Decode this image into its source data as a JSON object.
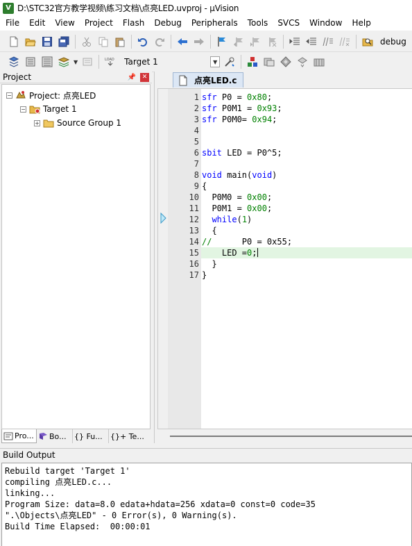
{
  "window": {
    "title": "D:\\STC32官方教学视频\\练习文档\\点亮LED.uvproj - µVision",
    "app_icon": "V"
  },
  "menu": [
    "File",
    "Edit",
    "View",
    "Project",
    "Flash",
    "Debug",
    "Peripherals",
    "Tools",
    "SVCS",
    "Window",
    "Help"
  ],
  "toolbar1": {
    "icons": [
      "new-file-icon",
      "open-folder-icon",
      "save-icon",
      "save-all-icon",
      "cut-icon",
      "copy-icon",
      "paste-icon",
      "undo-icon",
      "redo-icon",
      "navigate-back-icon",
      "navigate-forward-icon",
      "bookmark-icon",
      "prev-bookmark-icon",
      "next-bookmark-icon",
      "clear-bookmarks-icon",
      "indent-icon",
      "unindent-icon",
      "comment-icon",
      "uncomment-icon",
      "find-in-files-icon"
    ],
    "debug_label": "debug"
  },
  "toolbar2": {
    "icons": [
      "translate-icon",
      "build-icon",
      "rebuild-icon",
      "batch-build-icon",
      "stop-build-icon",
      "download-icon",
      "target-options-icon",
      "manage-components-icon",
      "select-packs-icon",
      "pack-installer-icon",
      "copy-config-icon"
    ],
    "target_value": "Target 1"
  },
  "project_panel": {
    "title": "Project",
    "tree": {
      "project": "Project: 点亮LED",
      "target": "Target 1",
      "group": "Source Group 1"
    },
    "tabs": [
      "Pro...",
      "Bo...",
      "{} Fu...",
      "{}+ Te..."
    ]
  },
  "editor": {
    "file_tab": "点亮LED.c",
    "line_numbers": [
      "1",
      "2",
      "3",
      "4",
      "5",
      "6",
      "7",
      "8",
      "9",
      "10",
      "11",
      "12",
      "13",
      "14",
      "15",
      "16",
      "17"
    ],
    "current_line": 15,
    "arrow_line": 12,
    "code": [
      [
        {
          "t": "sfr",
          "c": "kw"
        },
        {
          "t": " P0 = ",
          "c": ""
        },
        {
          "t": "0x80",
          "c": "num"
        },
        {
          "t": ";",
          "c": ""
        }
      ],
      [
        {
          "t": "sfr",
          "c": "kw"
        },
        {
          "t": " P0M1 = ",
          "c": ""
        },
        {
          "t": "0x93",
          "c": "num"
        },
        {
          "t": ";",
          "c": ""
        }
      ],
      [
        {
          "t": "sfr",
          "c": "kw"
        },
        {
          "t": " P0M0= ",
          "c": ""
        },
        {
          "t": "0x94",
          "c": "num"
        },
        {
          "t": ";",
          "c": ""
        }
      ],
      [],
      [],
      [
        {
          "t": "sbit",
          "c": "kw"
        },
        {
          "t": " LED = P0^5;",
          "c": ""
        }
      ],
      [],
      [
        {
          "t": "void",
          "c": "kw"
        },
        {
          "t": " main(",
          "c": ""
        },
        {
          "t": "void",
          "c": "kw"
        },
        {
          "t": ")",
          "c": ""
        }
      ],
      [
        {
          "t": "{",
          "c": ""
        }
      ],
      [
        {
          "t": "  P0M0 = ",
          "c": ""
        },
        {
          "t": "0x00",
          "c": "num"
        },
        {
          "t": ";",
          "c": ""
        }
      ],
      [
        {
          "t": "  P0M1 = ",
          "c": ""
        },
        {
          "t": "0x00",
          "c": "num"
        },
        {
          "t": ";",
          "c": ""
        }
      ],
      [
        {
          "t": "  ",
          "c": ""
        },
        {
          "t": "while",
          "c": "kw"
        },
        {
          "t": "(",
          "c": ""
        },
        {
          "t": "1",
          "c": "num"
        },
        {
          "t": ")",
          "c": ""
        }
      ],
      [
        {
          "t": "  {",
          "c": ""
        }
      ],
      [
        {
          "t": "//",
          "c": "cm"
        },
        {
          "t": "      P0 = 0x55;",
          "c": ""
        }
      ],
      [
        {
          "t": "    LED =",
          "c": ""
        },
        {
          "t": "0",
          "c": "num"
        },
        {
          "t": ";",
          "c": ""
        }
      ],
      [
        {
          "t": "  }",
          "c": ""
        }
      ],
      [
        {
          "t": "}",
          "c": ""
        }
      ]
    ]
  },
  "build_output": {
    "title": "Build Output",
    "lines": [
      "Rebuild target 'Target 1'",
      "compiling 点亮LED.c...",
      "linking...",
      "Program Size: data=8.0 edata+hdata=256 xdata=0 const=0 code=35",
      "\".\\Objects\\点亮LED\" - 0 Error(s), 0 Warning(s).",
      "Build Time Elapsed:  00:00:01"
    ]
  }
}
